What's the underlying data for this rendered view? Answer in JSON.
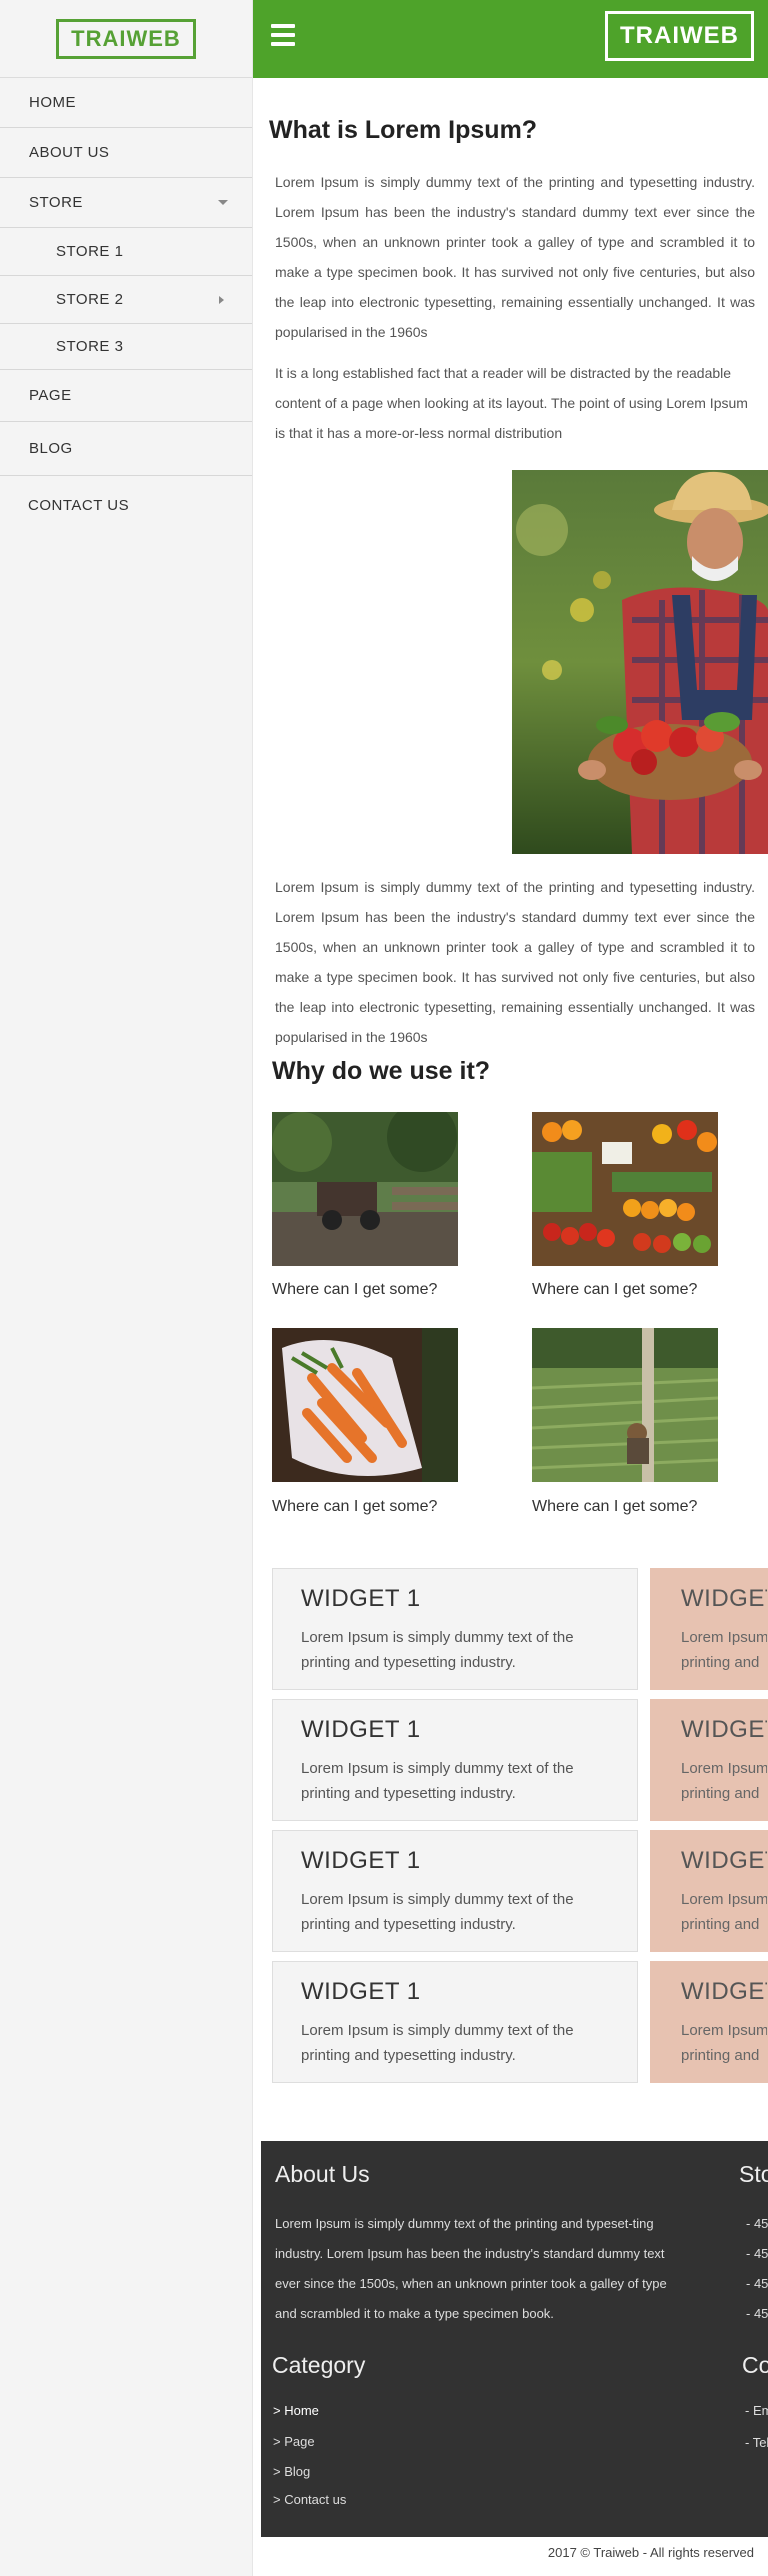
{
  "brand": {
    "logo_text": "TRAIWEB",
    "accent": "#4ea32a"
  },
  "sidebar": {
    "items": [
      {
        "label": "HOME"
      },
      {
        "label": "ABOUT US"
      },
      {
        "label": "STORE"
      },
      {
        "label": "STORE 1"
      },
      {
        "label": "STORE 2"
      },
      {
        "label": "STORE 3"
      },
      {
        "label": "PAGE"
      },
      {
        "label": "BLOG"
      },
      {
        "label": "CONTACT US"
      }
    ]
  },
  "article": {
    "title": "What is Lorem Ipsum?",
    "para1": "Lorem Ipsum is simply dummy text of the printing and typesetting industry. Lorem Ipsum has been the industry's standard dummy text ever since the 1500s, when an unknown printer took a galley of type and scrambled it to make a type specimen book. It has survived not only five centuries, but also the leap into electronic typesetting, remaining essentially unchanged. It was popularised in the 1960s",
    "para2": "It is a long established fact that a reader will be distracted by the readable content of a page when looking at its layout. The point of using Lorem Ipsum is that it has a more-or-less normal distribution",
    "para3": "Lorem Ipsum is simply dummy text of the printing and typesetting industry. Lorem Ipsum has been the industry's standard dummy text ever since the 1500s, when an unknown printer took a galley of type and scrambled it to make a type specimen book. It has survived not only five centuries, but also the leap into electronic typesetting, remaining essentially unchanged. It was popularised in the 1960s",
    "why_title": "Why do we use it?"
  },
  "gallery": [
    {
      "caption": "Where can I get some?"
    },
    {
      "caption": "Where can I get some?"
    },
    {
      "caption": "Where can I get some?"
    },
    {
      "caption": "Where can I get some?"
    }
  ],
  "widgets": [
    {
      "title": "WIDGET 1",
      "text": "Lorem Ipsum is simply dummy text of the printing and typesetting industry.",
      "side_title": "WIDGET",
      "side_text": "Lorem Ipsum printing and"
    },
    {
      "title": "WIDGET 1",
      "text": "Lorem Ipsum is simply dummy text of the printing and typesetting industry.",
      "side_title": "WIDGET",
      "side_text": "Lorem Ipsum printing and"
    },
    {
      "title": "WIDGET 1",
      "text": "Lorem Ipsum is simply dummy text of the printing and typesetting industry.",
      "side_title": "WIDGET",
      "side_text": "Lorem Ipsum printing and"
    },
    {
      "title": "WIDGET 1",
      "text": "Lorem Ipsum is simply dummy text of the printing and typesetting industry.",
      "side_title": "WIDGET",
      "side_text": "Lorem Ipsum printing and"
    }
  ],
  "footer": {
    "about_title": "About Us",
    "about_text": "Lorem Ipsum is simply dummy text of the printing and typeset-ting industry. Lorem Ipsum has been the industry's standard dummy text ever since the 1500s, when an unknown printer took a galley of type and scrambled it to make a type specimen book.",
    "store_title": "Sto",
    "store_items": [
      "- 45/",
      "- 45/",
      "- 45/",
      "- 45/"
    ],
    "category_title": "Category",
    "category_links": [
      ">  Home",
      ">  Page",
      ">  Blog",
      ">  Contact us"
    ],
    "contact_title": "Co",
    "contact_items": [
      "- Ema",
      "- Tel:"
    ]
  },
  "copyright": "2017 © Traiweb - All rights reserved"
}
